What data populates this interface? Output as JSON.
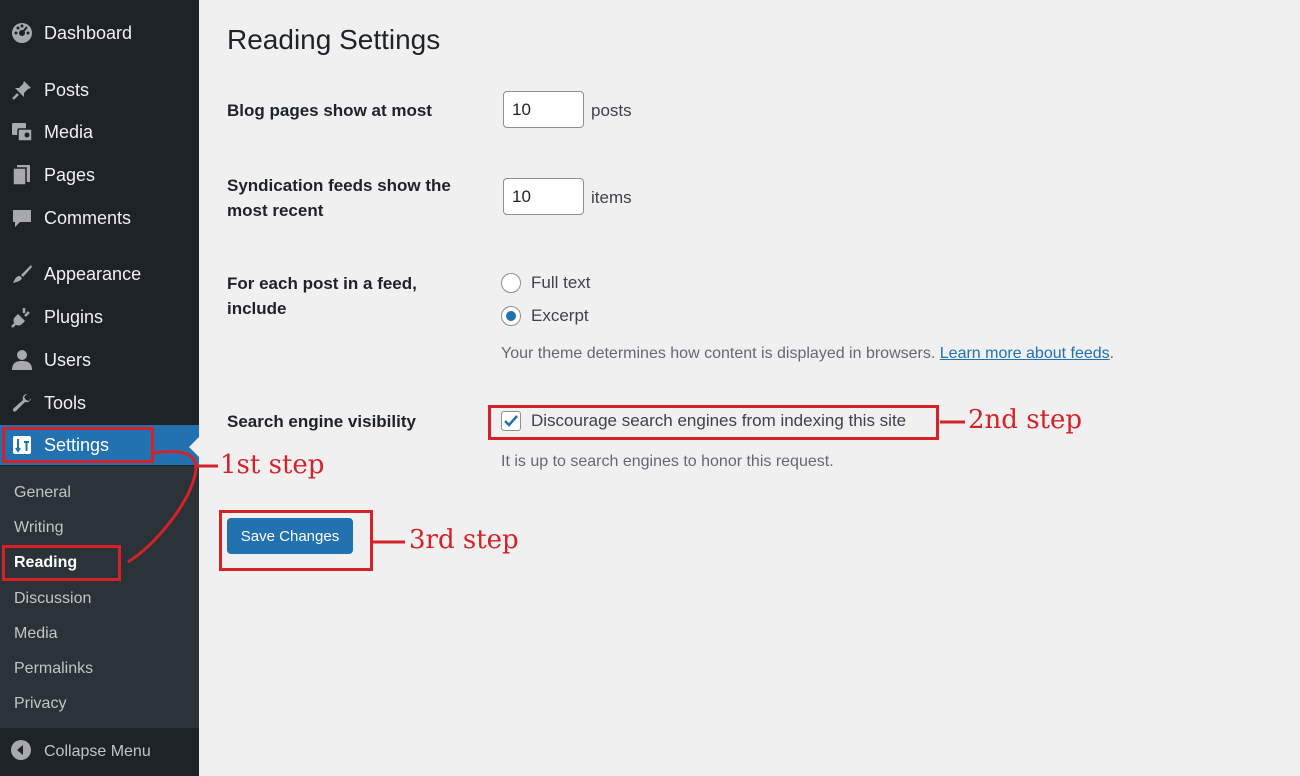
{
  "sidebar": {
    "menu": [
      {
        "label": "Dashboard",
        "icon": "dashboard-icon"
      },
      {
        "label": "Posts",
        "icon": "pin-icon"
      },
      {
        "label": "Media",
        "icon": "media-icon"
      },
      {
        "label": "Pages",
        "icon": "pages-icon"
      },
      {
        "label": "Comments",
        "icon": "comment-icon"
      },
      {
        "label": "Appearance",
        "icon": "brush-icon"
      },
      {
        "label": "Plugins",
        "icon": "plugin-icon"
      },
      {
        "label": "Users",
        "icon": "user-icon"
      },
      {
        "label": "Tools",
        "icon": "wrench-icon"
      },
      {
        "label": "Settings",
        "icon": "settings-icon"
      }
    ],
    "submenu": [
      "General",
      "Writing",
      "Reading",
      "Discussion",
      "Media",
      "Permalinks",
      "Privacy"
    ],
    "current_submenu": "Reading",
    "collapse_label": "Collapse Menu"
  },
  "page": {
    "title": "Reading Settings",
    "blog_pages": {
      "label": "Blog pages show at most",
      "value": "10",
      "unit": "posts"
    },
    "syndication": {
      "label": "Syndication feeds show the most recent",
      "value": "10",
      "unit": "items"
    },
    "feed_include": {
      "label": "For each post in a feed, include",
      "options": [
        "Full text",
        "Excerpt"
      ],
      "selected": "Excerpt",
      "description": "Your theme determines how content is displayed in browsers.",
      "link_text": "Learn more about feeds",
      "link_suffix": "."
    },
    "search_visibility": {
      "label": "Search engine visibility",
      "checkbox_label": "Discourage search engines from indexing this site",
      "checked": true,
      "description": "It is up to search engines to honor this request."
    },
    "save_label": "Save Changes"
  },
  "annotations": {
    "step1": "1st step",
    "step2": "2nd step",
    "step3": "3rd step"
  },
  "colors": {
    "sidebar_bg": "#1d2327",
    "submenu_bg": "#2c3338",
    "accent": "#2271b1",
    "annotation": "#d62128",
    "page_bg": "#f0f0f1"
  }
}
